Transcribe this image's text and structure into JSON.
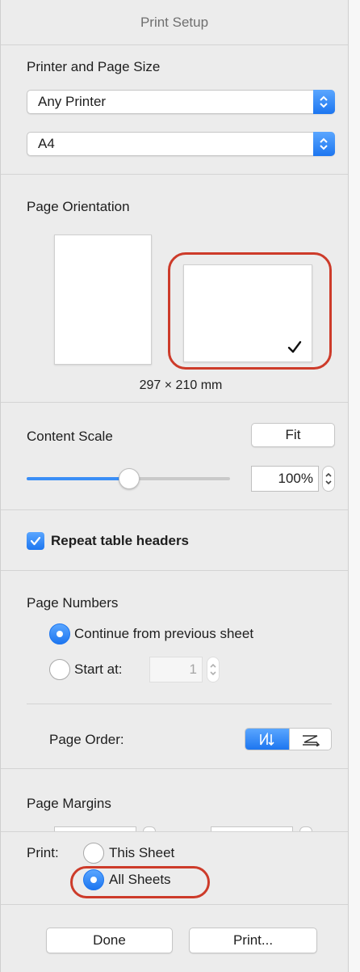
{
  "window": {
    "title": "Print Setup"
  },
  "printer_section": {
    "heading": "Printer and Page Size",
    "printer_value": "Any Printer",
    "paper_value": "A4"
  },
  "orientation_section": {
    "heading": "Page Orientation",
    "selected": "landscape",
    "page_size": "297 × 210 mm"
  },
  "scale_section": {
    "heading": "Content Scale",
    "fit_label": "Fit",
    "value": "100%",
    "slider_fraction": 0.49
  },
  "repeat_headers": {
    "label": "Repeat table headers",
    "checked": true
  },
  "page_numbers": {
    "heading": "Page Numbers",
    "option_continue": "Continue from previous sheet",
    "option_start": "Start at:",
    "start_value": "1",
    "selected": "continue"
  },
  "page_order": {
    "label": "Page Order:",
    "selected": "down-then-over"
  },
  "page_margins": {
    "heading": "Page Margins"
  },
  "print_scope": {
    "label": "Print:",
    "option_this": "This Sheet",
    "option_all": "All Sheets",
    "selected": "all"
  },
  "footer": {
    "done_label": "Done",
    "print_label": "Print..."
  },
  "colors": {
    "accent": "#1d76f0",
    "highlight": "#cd3b2a"
  }
}
